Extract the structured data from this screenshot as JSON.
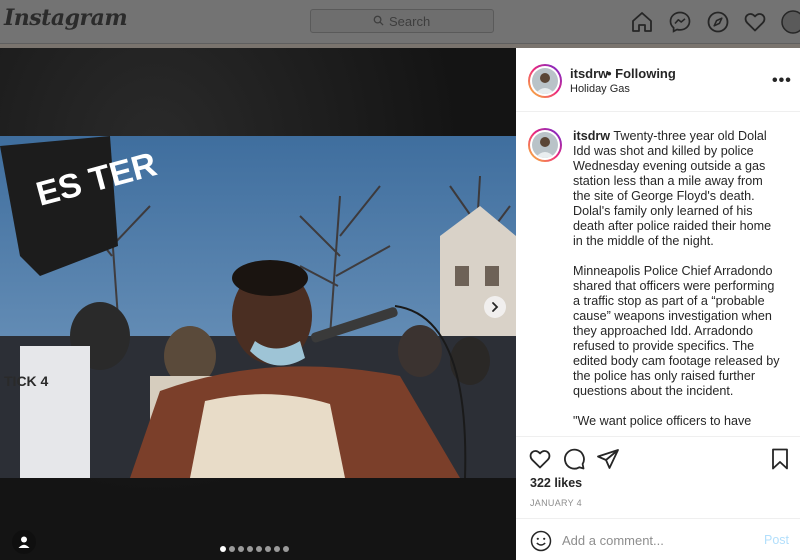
{
  "app": {
    "logo_text": "Instagram"
  },
  "topbar": {
    "search_placeholder": "Search",
    "icons": [
      "home-icon",
      "messenger-icon",
      "explore-icon",
      "heart-icon",
      "profile-avatar"
    ]
  },
  "post": {
    "username": "itsdrw",
    "follow_status": "• Following",
    "location": "Holiday Gas",
    "more_label": "•••",
    "caption_paragraphs": [
      "Twenty-three year old Dolal Idd was shot and killed by police Wednesday evening outside a gas station less than a mile away from the site of George Floyd's death. Dolal's family only learned of his death after police raided their home in the middle of the night.",
      "Minneapolis Police Chief Arradondo shared that officers were performing a traffic stop as part of a “probable cause” weapons investigation when they approached Idd.  Arradondo refused to provide specifics. The edited body cam footage released by the police has only raised further questions about the incident.",
      "\"We want police officers to have"
    ],
    "likes": "322 likes",
    "date": "JANUARY 4",
    "comment_placeholder": "Add a comment...",
    "post_button": "Post",
    "carousel": {
      "total_slides": 8,
      "active_index": 0
    },
    "sign_text": "ES TER",
    "shirt_text": "TICK 4",
    "colors": {
      "accent_link": "#b2dffc",
      "text": "#262626",
      "muted": "#8e8e8e"
    }
  }
}
